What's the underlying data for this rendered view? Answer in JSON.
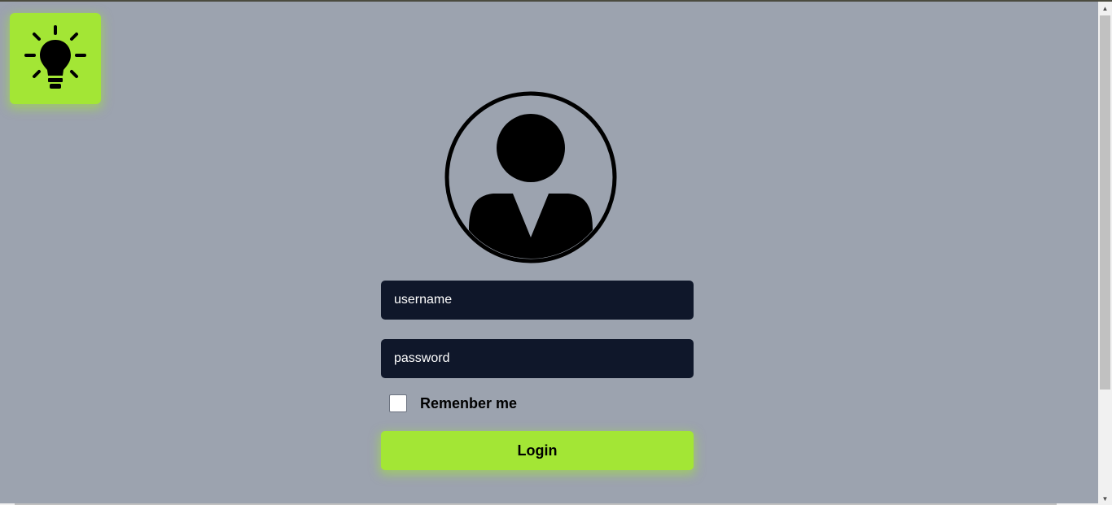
{
  "theme_toggle": {
    "icon": "lightbulb-icon"
  },
  "avatar": {
    "icon": "user-avatar-icon"
  },
  "form": {
    "username_placeholder": "username",
    "password_placeholder": "password",
    "remember_label": "Remenber me",
    "login_label": "Login"
  },
  "colors": {
    "background": "#9ca3af",
    "accent": "#a3e635",
    "field": "#0f172a"
  }
}
